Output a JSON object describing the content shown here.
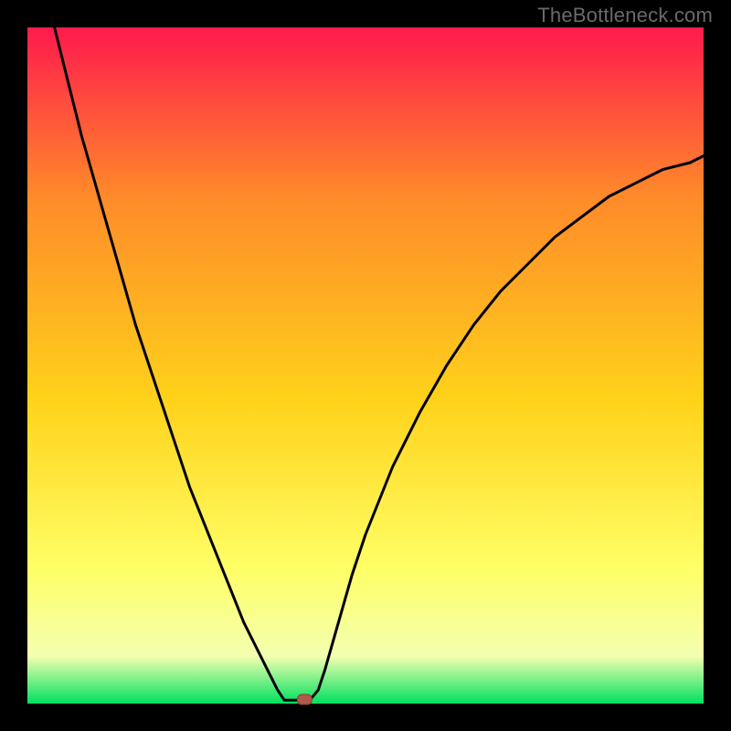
{
  "watermark": "TheBottleneck.com",
  "colors": {
    "frame": "#000000",
    "curve": "#000000",
    "marker_fill": "#b05a4a",
    "marker_stroke": "#8a3f34",
    "grad_top": "#ff1a4d",
    "grad_mid1": "#ff8a2a",
    "grad_mid2": "#ffd21a",
    "grad_mid3": "#ffff66",
    "grad_mid4": "#f4ffb0",
    "grad_bottom": "#00e060"
  },
  "chart_data": {
    "type": "line",
    "title": "",
    "xlabel": "",
    "ylabel": "",
    "xlim": [
      0,
      100
    ],
    "ylim": [
      0,
      100
    ],
    "curve": [
      {
        "x": 4,
        "y": 100
      },
      {
        "x": 6,
        "y": 92
      },
      {
        "x": 8,
        "y": 84
      },
      {
        "x": 10,
        "y": 77
      },
      {
        "x": 12,
        "y": 70
      },
      {
        "x": 14,
        "y": 63
      },
      {
        "x": 16,
        "y": 56
      },
      {
        "x": 18,
        "y": 50
      },
      {
        "x": 20,
        "y": 44
      },
      {
        "x": 22,
        "y": 38
      },
      {
        "x": 24,
        "y": 32
      },
      {
        "x": 26,
        "y": 27
      },
      {
        "x": 28,
        "y": 22
      },
      {
        "x": 30,
        "y": 17
      },
      {
        "x": 32,
        "y": 12
      },
      {
        "x": 34,
        "y": 8
      },
      {
        "x": 36,
        "y": 4
      },
      {
        "x": 37,
        "y": 2
      },
      {
        "x": 38,
        "y": 0.5
      },
      {
        "x": 40,
        "y": 0.5
      },
      {
        "x": 42,
        "y": 0.8
      },
      {
        "x": 43,
        "y": 2
      },
      {
        "x": 44,
        "y": 5
      },
      {
        "x": 46,
        "y": 12
      },
      {
        "x": 48,
        "y": 19
      },
      {
        "x": 50,
        "y": 25
      },
      {
        "x": 54,
        "y": 35
      },
      {
        "x": 58,
        "y": 43
      },
      {
        "x": 62,
        "y": 50
      },
      {
        "x": 66,
        "y": 56
      },
      {
        "x": 70,
        "y": 61
      },
      {
        "x": 74,
        "y": 65
      },
      {
        "x": 78,
        "y": 69
      },
      {
        "x": 82,
        "y": 72
      },
      {
        "x": 86,
        "y": 75
      },
      {
        "x": 90,
        "y": 77
      },
      {
        "x": 94,
        "y": 79
      },
      {
        "x": 98,
        "y": 80
      },
      {
        "x": 100,
        "y": 81
      }
    ],
    "marker": {
      "x": 41,
      "y": 0.6
    }
  }
}
